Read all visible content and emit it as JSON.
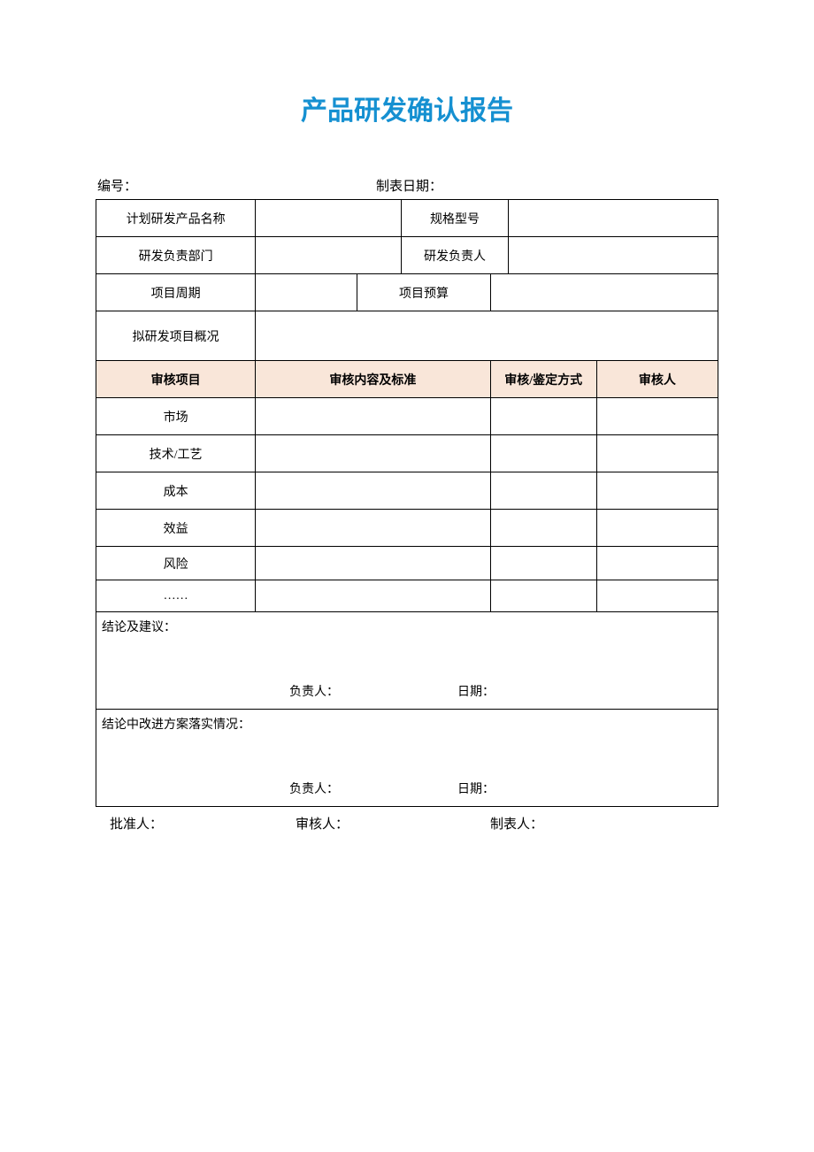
{
  "title": "产品研发确认报告",
  "header": {
    "doc_number_label": "编号：",
    "date_label": "制表日期："
  },
  "info_rows": {
    "r1_l": "计划研发产品名称",
    "r1_r": "规格型号",
    "r2_l": "研发负责部门",
    "r2_r": "研发负责人",
    "r3_l": "项目周期",
    "r3_r": "项目预算",
    "r4_l": "拟研发项目概况"
  },
  "review_header": {
    "c1": "审核项目",
    "c2": "审核内容及标准",
    "c3": "审核/鉴定方式",
    "c4": "审核人"
  },
  "review_items": {
    "i1": "市场",
    "i2": "技术/工艺",
    "i3": "成本",
    "i4": "效益",
    "i5": "风险",
    "i6": "……"
  },
  "conclusion": {
    "label": "结论及建议：",
    "person_label": "负责人：",
    "date_label": "日期："
  },
  "improvement": {
    "label": "结论中改进方案落实情况：",
    "person_label": "负责人：",
    "date_label": "日期："
  },
  "footer": {
    "approver_label": "批准人：",
    "reviewer_label": "审核人：",
    "preparer_label": "制表人："
  }
}
